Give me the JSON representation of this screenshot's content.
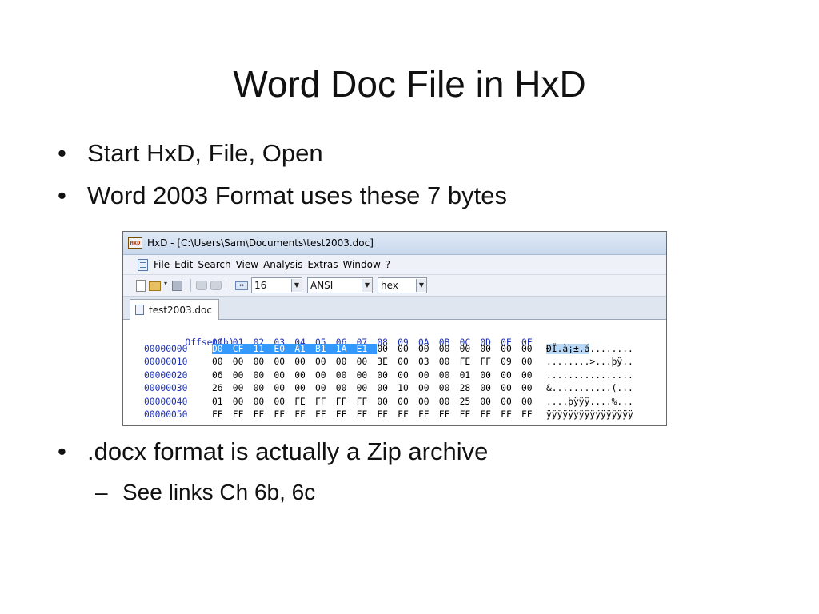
{
  "slide": {
    "title": "Word Doc File in HxD",
    "bullets": [
      {
        "marker": "•",
        "text": "Start HxD, File, Open"
      },
      {
        "marker": "•",
        "text": "Word 2003 Format uses these 7 bytes"
      },
      {
        "marker": "•",
        "text": ".docx format is actually a Zip archive"
      }
    ],
    "sub_bullet": {
      "marker": "–",
      "text": "See links Ch 6b, 6c"
    }
  },
  "hxd": {
    "icon_text": "HxD",
    "window_title": "HxD - [C:\\Users\\Sam\\Documents\\test2003.doc]",
    "menu": [
      "File",
      "Edit",
      "Search",
      "View",
      "Analysis",
      "Extras",
      "Window",
      "?"
    ],
    "toolbar": {
      "columns_value": "16",
      "charset_value": "ANSI",
      "offset_base_value": "hex"
    },
    "tab_label": "test2003.doc",
    "offset_header": "Offset(h)",
    "column_headers": [
      "00",
      "01",
      "02",
      "03",
      "04",
      "05",
      "06",
      "07",
      "08",
      "09",
      "0A",
      "0B",
      "0C",
      "0D",
      "0E",
      "0F"
    ],
    "rows": [
      {
        "offset": "00000000",
        "bytes": [
          "D0",
          "CF",
          "11",
          "E0",
          "A1",
          "B1",
          "1A",
          "E1",
          "00",
          "00",
          "00",
          "00",
          "00",
          "00",
          "00",
          "00"
        ],
        "ascii_sel": "ÐÏ.à¡±.á",
        "ascii_rest": "........"
      },
      {
        "offset": "00000010",
        "bytes": [
          "00",
          "00",
          "00",
          "00",
          "00",
          "00",
          "00",
          "00",
          "3E",
          "00",
          "03",
          "00",
          "FE",
          "FF",
          "09",
          "00"
        ],
        "ascii_sel": "",
        "ascii_rest": "........>...þÿ.."
      },
      {
        "offset": "00000020",
        "bytes": [
          "06",
          "00",
          "00",
          "00",
          "00",
          "00",
          "00",
          "00",
          "00",
          "00",
          "00",
          "00",
          "01",
          "00",
          "00",
          "00"
        ],
        "ascii_sel": "",
        "ascii_rest": "................"
      },
      {
        "offset": "00000030",
        "bytes": [
          "26",
          "00",
          "00",
          "00",
          "00",
          "00",
          "00",
          "00",
          "00",
          "10",
          "00",
          "00",
          "28",
          "00",
          "00",
          "00"
        ],
        "ascii_sel": "",
        "ascii_rest": "&...........(..."
      },
      {
        "offset": "00000040",
        "bytes": [
          "01",
          "00",
          "00",
          "00",
          "FE",
          "FF",
          "FF",
          "FF",
          "00",
          "00",
          "00",
          "00",
          "25",
          "00",
          "00",
          "00"
        ],
        "ascii_sel": "",
        "ascii_rest": "....þÿÿÿ....%..."
      },
      {
        "offset": "00000050",
        "bytes": [
          "FF",
          "FF",
          "FF",
          "FF",
          "FF",
          "FF",
          "FF",
          "FF",
          "FF",
          "FF",
          "FF",
          "FF",
          "FF",
          "FF",
          "FF",
          "FF"
        ],
        "ascii_sel": "",
        "ascii_rest": "ÿÿÿÿÿÿÿÿÿÿÿÿÿÿÿÿ"
      }
    ],
    "selected_byte_count": 8,
    "colors": {
      "offset_text": "#1c30b8",
      "selection": "#3399ff"
    }
  }
}
